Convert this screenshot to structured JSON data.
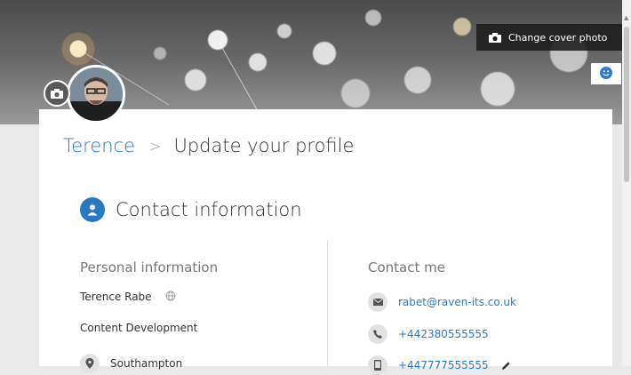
{
  "cover": {
    "change_label": "Change cover photo"
  },
  "breadcrumb": {
    "home": "Terence",
    "separator": ">",
    "current": "Update your profile"
  },
  "section": {
    "title": "Contact information"
  },
  "personal": {
    "heading": "Personal information",
    "name": "Terence Rabe",
    "department": "Content Development",
    "location": "Southampton"
  },
  "contact": {
    "heading": "Contact me",
    "email": "rabet@raven-its.co.uk",
    "phone": "+442380555555",
    "mobile": "+447777555555"
  },
  "colors": {
    "accent": "#2d7bbf",
    "badge": "#2a7ac3"
  },
  "icons": [
    "camera-icon",
    "smiley-icon",
    "person-icon",
    "globe-icon",
    "mail-icon",
    "phone-icon",
    "mobile-icon",
    "pencil-icon",
    "location-icon"
  ]
}
